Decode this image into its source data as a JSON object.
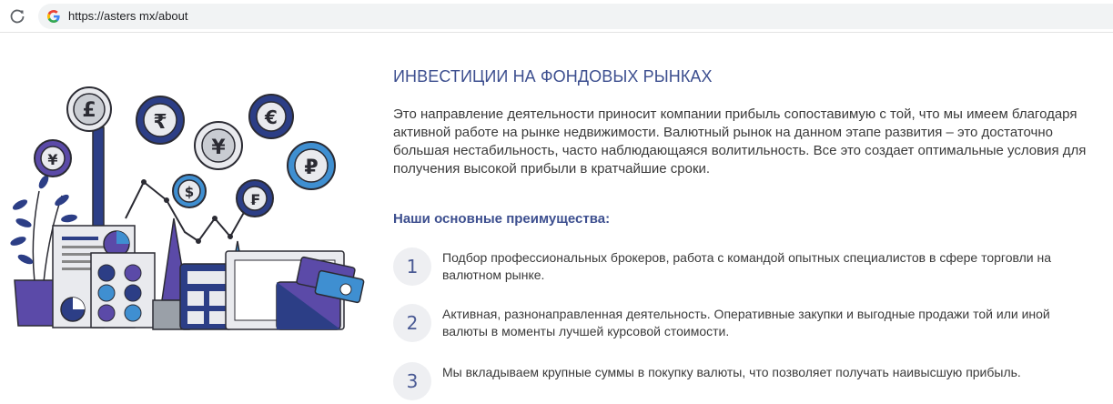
{
  "browser": {
    "url": "https://asters mx/about"
  },
  "illustration": {
    "coins": [
      "£",
      "₹",
      "€",
      "¥",
      "¥",
      "$",
      "₽",
      "₣"
    ]
  },
  "main": {
    "title": "ИНВЕСТИЦИИ НА ФОНДОВЫХ РЫНКАХ",
    "intro": "Это направление деятельности приносит компании прибыль сопоставимую с той, что мы имеем благодаря активной работе на рынке недвижимости. Валютный рынок на данном этапе развития – это достаточно большая нестабильность, часто наблюдающаяся волитильность. Все это создает оптимальные условия для получения высокой прибыли в кратчайшие сроки.",
    "advantages_title": "Наши основные преимущества:",
    "advantages": [
      {
        "num": "1",
        "text": "Подбор профессиональных брокеров, работа с командой опытных специалистов в сфере торговли на валютном рынке."
      },
      {
        "num": "2",
        "text": "Активная, разнонаправленная деятельность. Оперативные закупки и выгодные продажи той или иной валюты в моменты лучшей курсовой стоимости."
      },
      {
        "num": "3",
        "text": "Мы вкладываем крупные суммы в покупку валюты, что позволяет получать наивысшую прибыль."
      }
    ]
  },
  "colors": {
    "accent": "#3d4f8f",
    "purple": "#5b4aa8",
    "navy": "#2c3e86",
    "blue": "#3f8fd1",
    "outline": "#2b2b33"
  }
}
